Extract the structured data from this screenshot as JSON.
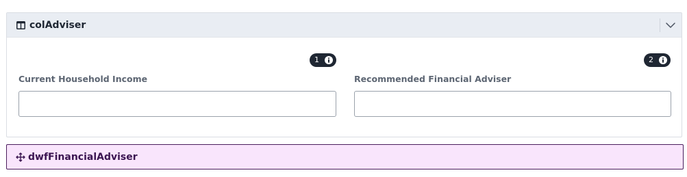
{
  "column_panel": {
    "title": "colAdviser",
    "header_icon": "columns-icon",
    "collapse_icon": "chevron-down-icon"
  },
  "fields": [
    {
      "badge_number": "1",
      "badge_icon": "info-icon",
      "label": "Current Household Income",
      "value": ""
    },
    {
      "badge_number": "2",
      "badge_icon": "info-icon",
      "label": "Recommended Financial Adviser",
      "value": ""
    }
  ],
  "dwf_component": {
    "label": "dwfFinancialAdviser",
    "icon": "move-icon"
  },
  "colors": {
    "header_bg": "#e9edf3",
    "badge_bg": "#1f2733",
    "dwf_bg": "#f9e5fc",
    "dwf_border": "#4a1d5c"
  }
}
